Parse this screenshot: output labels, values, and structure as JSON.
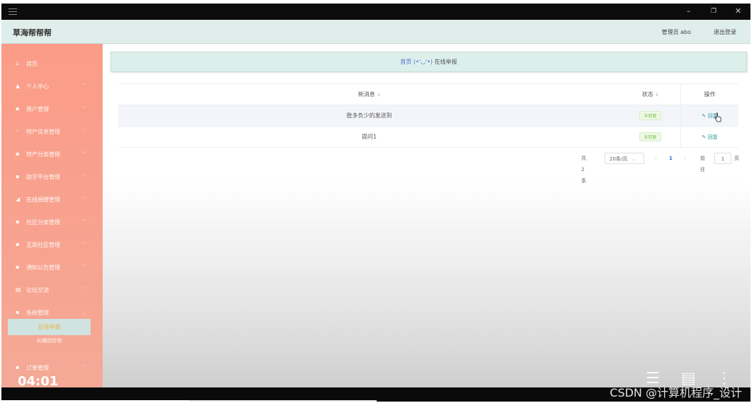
{
  "app": {
    "title": "草海帮帮帮",
    "user_label": "管理员 abo",
    "logout_label": "退出登录"
  },
  "window_controls": [
    "–",
    "❐",
    "✕"
  ],
  "sidebar": {
    "items": [
      {
        "icon": "home-icon",
        "glyph": "⌂",
        "label": "首页"
      },
      {
        "icon": "user-icon",
        "glyph": "▲",
        "label": "个人中心"
      },
      {
        "icon": "grid-icon",
        "glyph": "▪",
        "label": "用户管理"
      },
      {
        "icon": "info-icon",
        "glyph": "◦",
        "label": "特产信息管理"
      },
      {
        "icon": "grid-icon",
        "glyph": "▪",
        "label": "特产分类管理"
      },
      {
        "icon": "grid-icon",
        "glyph": "▪",
        "label": "助学平台管理"
      },
      {
        "icon": "send-icon",
        "glyph": "◢",
        "label": "在线捐赠管理"
      },
      {
        "icon": "grid-icon",
        "glyph": "▪",
        "label": "社区分类管理"
      },
      {
        "icon": "grid-icon",
        "glyph": "▪",
        "label": "互助社区管理"
      },
      {
        "icon": "grid-icon",
        "glyph": "▪",
        "label": "通知公告管理"
      },
      {
        "icon": "list-icon",
        "glyph": "▤",
        "label": "论坛交流"
      },
      {
        "icon": "grid-icon",
        "glyph": "▪",
        "label": "系统管理"
      }
    ],
    "sub_active": "在线举报",
    "sub_item": "轮播图管理",
    "last_item": {
      "icon": "grid-icon",
      "glyph": "▪",
      "label": "订单管理"
    },
    "clock": "04:01"
  },
  "breadcrumb": {
    "home": "首页",
    "face": "(•'◡'•)",
    "current": "在线举报"
  },
  "table": {
    "headers": {
      "message": "新消息",
      "status": "状态",
      "actions": "操作"
    },
    "rows": [
      {
        "message": "胜多负少的发送到",
        "status": "未回复",
        "action": "回复"
      },
      {
        "message": "提问1",
        "status": "未回复",
        "action": "回复"
      }
    ]
  },
  "pager": {
    "total": "共 2 条",
    "page_size": "20条/页",
    "current_page": "1",
    "goto_label": "前往",
    "goto_value": "1",
    "page_unit": "页"
  },
  "watermark": "CSDN @计算机程序_设计",
  "video_progress": 0.5
}
